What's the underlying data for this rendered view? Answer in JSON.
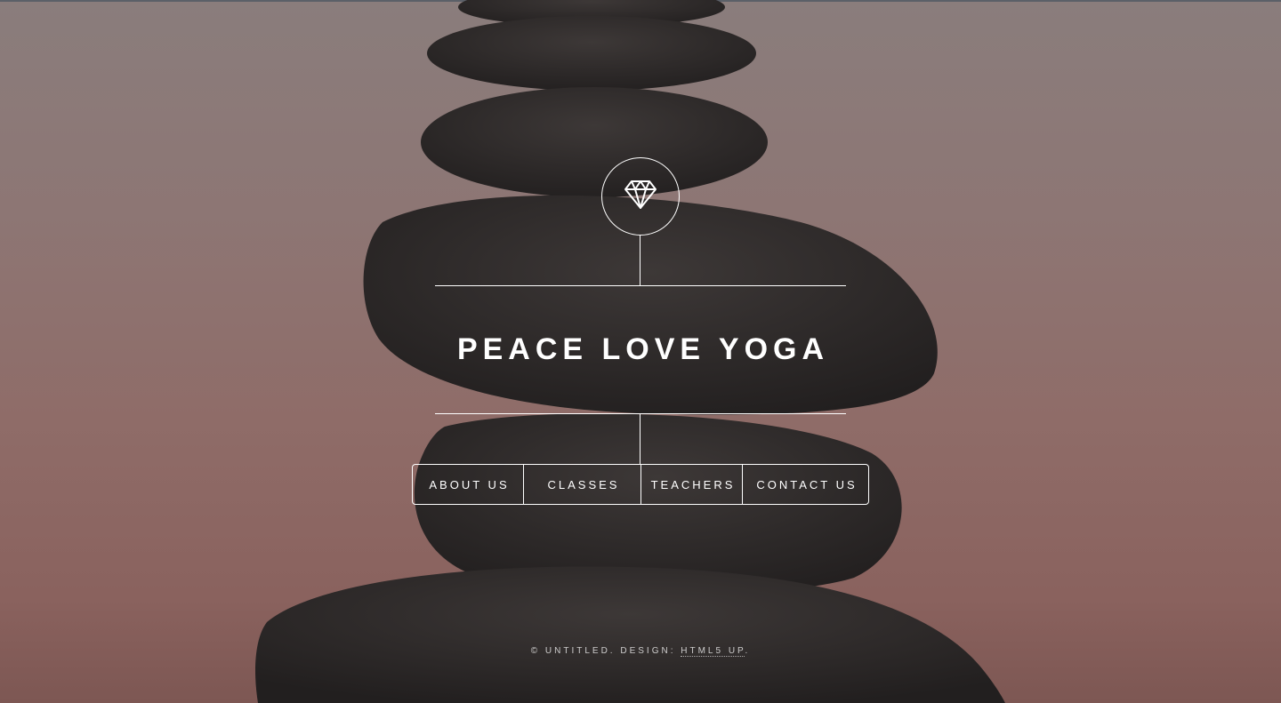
{
  "colors": {
    "background_top": "#8a7d7c",
    "background_bottom": "#7d5753",
    "stone": "#2b2727",
    "text": "#ffffff"
  },
  "header": {
    "logo_icon": "diamond-icon",
    "title": "PEACE LOVE YOGA"
  },
  "nav": {
    "items": [
      {
        "label": "ABOUT US"
      },
      {
        "label": "CLASSES"
      },
      {
        "label": "TEACHERS"
      },
      {
        "label": "CONTACT US"
      }
    ]
  },
  "footer": {
    "copyright": "© UNTITLED. DESIGN: ",
    "link_text": "HTML5 UP",
    "suffix": "."
  }
}
